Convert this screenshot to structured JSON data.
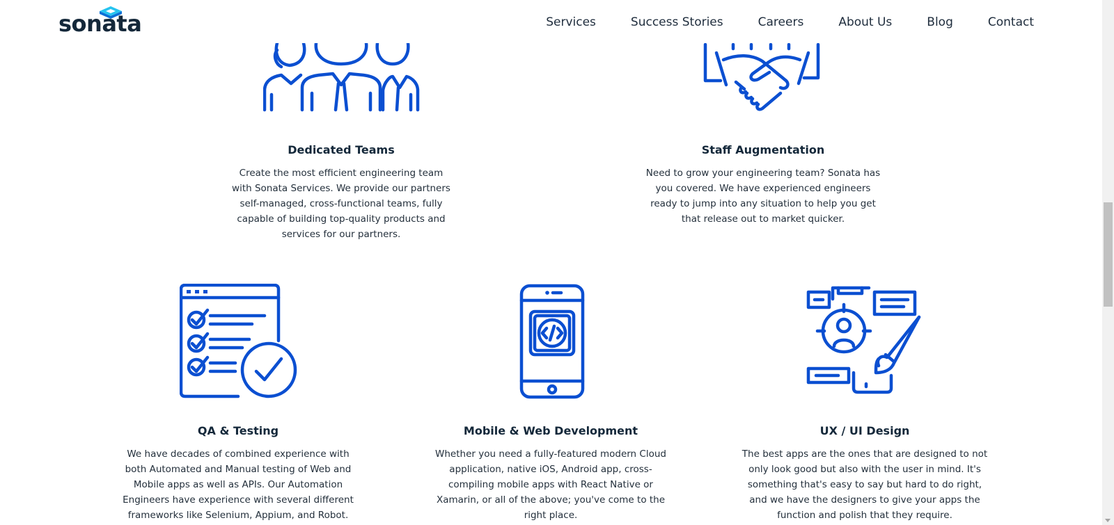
{
  "brand": {
    "name": "sonata",
    "accent": "#0b4fd1",
    "text_color": "#14283a"
  },
  "nav": {
    "items": [
      {
        "label": "Services"
      },
      {
        "label": "Success Stories"
      },
      {
        "label": "Careers"
      },
      {
        "label": "About Us"
      },
      {
        "label": "Blog"
      },
      {
        "label": "Contact"
      }
    ]
  },
  "services": {
    "dedicated_teams": {
      "icon": "team-people-icon",
      "title": "Dedicated Teams",
      "description": "Create the most efficient engineering team with Sonata Services. We provide our partners self-managed, cross-functional teams, fully capable of building top-quality products and services for our partners."
    },
    "staff_augmentation": {
      "icon": "handshake-icon",
      "title": "Staff Augmentation",
      "description": "Need to grow your engineering team? Sonata has you covered. We have experienced engineers ready to jump into any situation to help you get that release out to market quicker."
    },
    "qa_testing": {
      "icon": "checklist-icon",
      "title": "QA & Testing",
      "description": "We have decades of combined experience with both Automated and Manual testing of Web and Mobile apps as well as APIs. Our Automation Engineers have experience with several different frameworks like Selenium, Appium, and Robot."
    },
    "mobile_web": {
      "icon": "mobile-code-icon",
      "title": "Mobile & Web Development",
      "description": "Whether you need a fully-featured modern Cloud application, native iOS, Android app, cross-compiling mobile apps with React Native or Xamarin, or all of the above; you've come to the right place."
    },
    "ux_ui": {
      "icon": "design-brush-icon",
      "title": "UX / UI Design",
      "description": "The best apps are the ones that are designed to not only look good but also with the user in mind. It's something that's easy to say but hard to do right, and we have the designers to give your apps the function and polish that they require."
    }
  }
}
